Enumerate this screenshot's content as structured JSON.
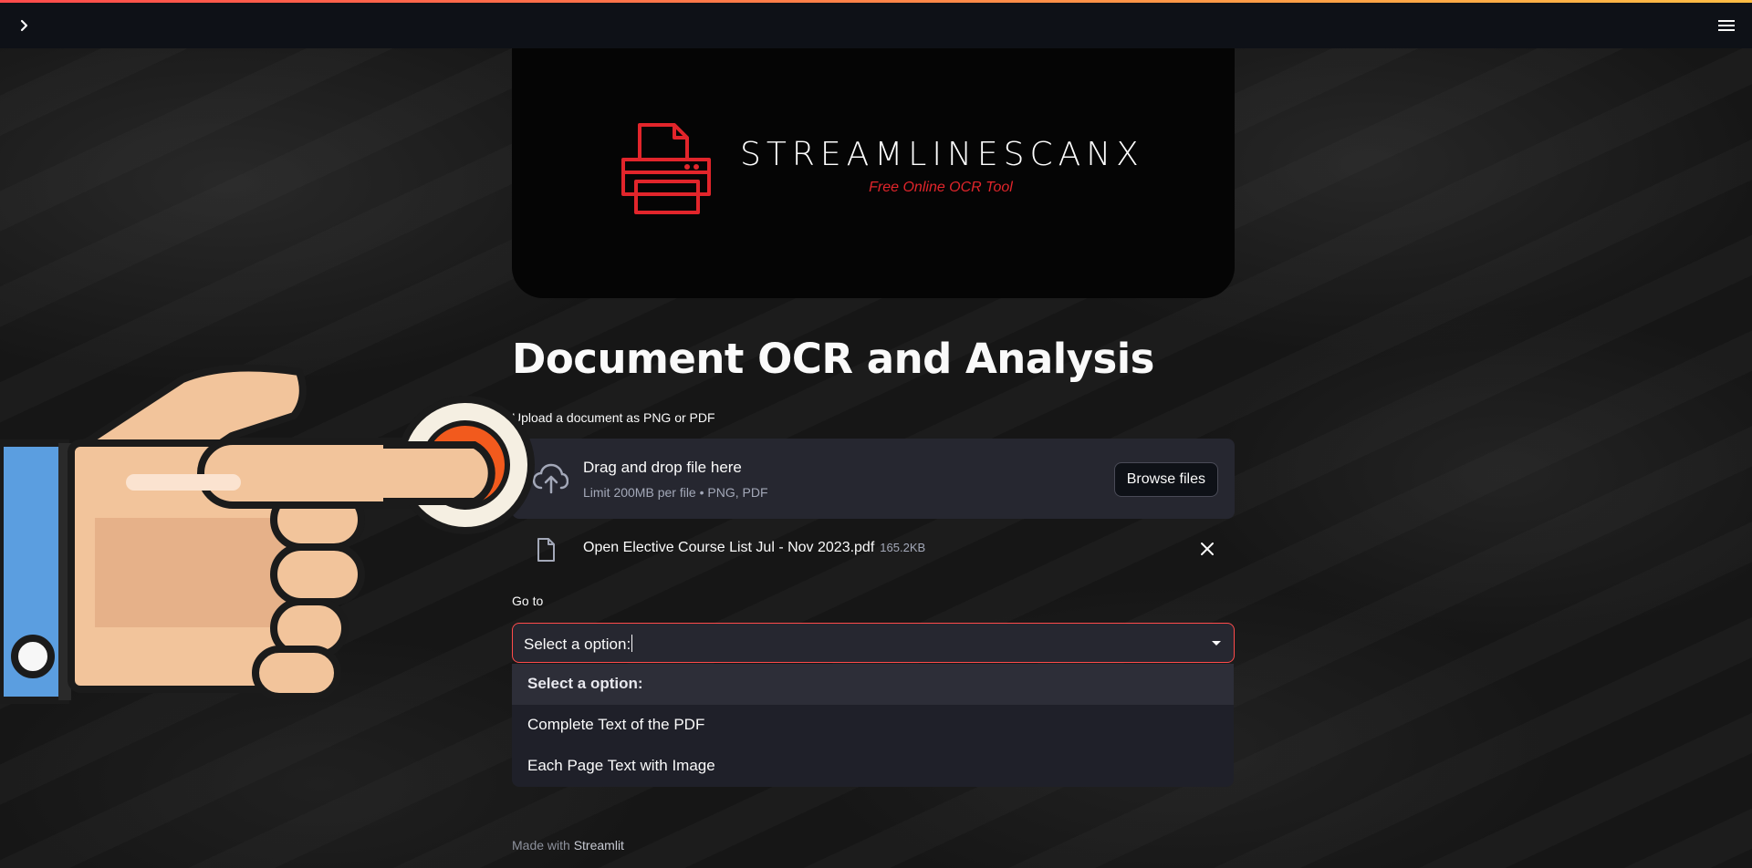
{
  "header": {
    "sidebar_toggle_icon": "chevron-right-icon",
    "menu_icon": "hamburger-menu-icon"
  },
  "logo": {
    "brand": "STREAMLINESCANX",
    "tagline": "Free Online OCR Tool",
    "icon": "printer-icon",
    "accent_color": "#e2252b"
  },
  "main": {
    "title": "Document OCR and Analysis",
    "upload": {
      "label": "Upload a document as PNG or PDF",
      "dropzone_title": "Drag and drop file here",
      "dropzone_limit": "Limit 200MB per file • PNG, PDF",
      "browse_button": "Browse files",
      "icon": "cloud-upload-icon"
    },
    "uploaded_file": {
      "name": "Open Elective Course List Jul - Nov 2023.pdf",
      "size": "165.2KB",
      "icon": "file-icon",
      "remove_icon": "close-icon"
    },
    "goto": {
      "label": "Go to",
      "select_value": "Select a option:",
      "options": [
        "Select a option:",
        "Complete Text of the PDF",
        "Each Page Text with Image"
      ],
      "highlighted_index": 0,
      "chevron_icon": "chevron-down-icon"
    }
  },
  "footer": {
    "prefix": "Made with",
    "link": "Streamlit"
  },
  "overlay": {
    "icon": "pointing-hand-icon"
  },
  "colors": {
    "header_bg": "#0e1117",
    "widget_bg": "#262730",
    "primary": "#ff4b4b",
    "stripe_end": "#ffbd45"
  }
}
